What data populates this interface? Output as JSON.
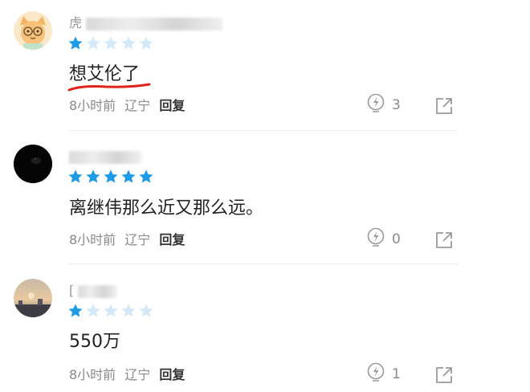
{
  "comments": [
    {
      "username_visible": "虎",
      "rating": 1,
      "content": "想艾伦了",
      "time": "8小时前",
      "location": "辽宁",
      "reply_label": "回复",
      "likes": "3"
    },
    {
      "username_visible": "",
      "rating": 5,
      "content": "离继伟那么近又那么远。",
      "time": "8小时前",
      "location": "辽宁",
      "reply_label": "回复",
      "likes": "0"
    },
    {
      "username_visible": "[",
      "rating": 1,
      "content": "550万",
      "time": "8小时前",
      "location": "辽宁",
      "reply_label": "回复",
      "likes": "1"
    }
  ],
  "colors": {
    "star_filled": "#1e9be6",
    "star_empty": "#d3e9f7",
    "underline_annotation": "#e0221b"
  },
  "icons": {
    "like": "lightbulb-icon",
    "share": "share-icon"
  }
}
